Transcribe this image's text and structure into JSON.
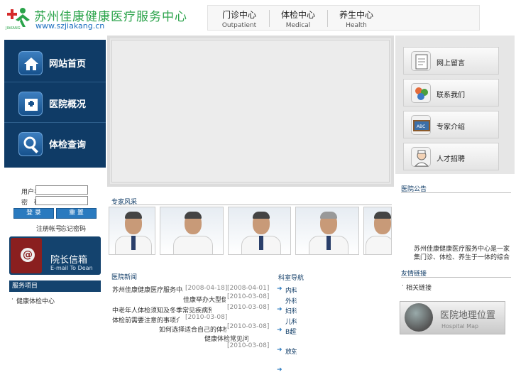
{
  "header": {
    "logo_name": "苏州佳康健康医疗服务中心",
    "logo_url": "www.szjiakang.cn",
    "logo_mark_text": "JIAKANG",
    "top_nav": [
      {
        "zh": "门诊中心",
        "en": "Outpatient"
      },
      {
        "zh": "体检中心",
        "en": "Medical"
      },
      {
        "zh": "养生中心",
        "en": "Health"
      }
    ]
  },
  "left_nav": [
    {
      "label": "网站首页",
      "icon": "home-icon"
    },
    {
      "label": "医院概况",
      "icon": "hospital-icon"
    },
    {
      "label": "体检查询",
      "icon": "magnifier-icon"
    }
  ],
  "login": {
    "user_label": "用户名",
    "pass_label": "密　码",
    "user_value": "",
    "pass_value": "",
    "login_btn": "登 录",
    "reset_btn": "重 置",
    "link_register": "注册帐号",
    "link_forgot": "忘记密码"
  },
  "dean": {
    "zh": "院长信箱",
    "en": "E-mail To Dean"
  },
  "left_section": {
    "title": "服务项目",
    "items": [
      "健康体检中心"
    ]
  },
  "center": {
    "experts_title": "专家风采",
    "news_title": "医院新闻",
    "news": [
      {
        "title": "苏州佳康健康医疗服务中心正式对外开放营业",
        "date": "[2008-04-18]"
      },
      {
        "title": "佳康举办大型健康知识讲座",
        "date": "[2008-04-01]"
      },
      {
        "title": "中老年人体检须知及冬季常见疾病预防保健知识讲解",
        "date": "[2010-03-08]"
      },
      {
        "title": "体检前需要注意的事项介绍",
        "date": "[2010-03-08]"
      },
      {
        "title": "如何选择适合自己的体检套餐",
        "date": "[2010-03-08]"
      },
      {
        "title": "健康体检常见问题解答",
        "date": "[2010-03-08]"
      },
      {
        "title": "",
        "date": "[2010-03-08]"
      }
    ],
    "dept_title": "科室导航",
    "dept_items": [
      "内科门诊",
      "外科",
      "妇科",
      "儿科门诊",
      "B超室",
      "放射科"
    ]
  },
  "right": {
    "buttons": [
      {
        "label": "网上留言",
        "icon": "clipboard-icon"
      },
      {
        "label": "联系我们",
        "icon": "contact-icon"
      },
      {
        "label": "专家介绍",
        "icon": "blackboard-icon"
      },
      {
        "label": "人才招聘",
        "icon": "doctor-icon"
      }
    ],
    "notice_title": "医院公告",
    "notice_text": "苏州佳康健康医疗服务中心是一家集门诊、体检、养生于一体的综合性医疗服务机构，占地约135-2平方米，拥有300余名专业医护人员。",
    "links_title": "友情链接",
    "links": [
      "相关链接"
    ],
    "map_zh": "医院地理位置",
    "map_en": "Hospital Map"
  }
}
